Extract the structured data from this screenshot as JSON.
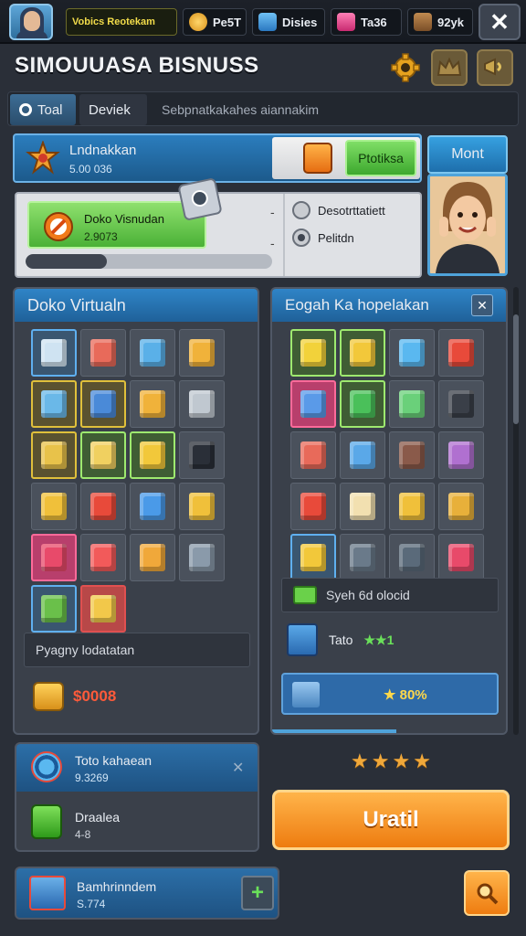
{
  "topbar": {
    "resources": [
      {
        "label": "Vobics Reotekam",
        "icon": "ribbon-icon",
        "color": "#d8c238"
      },
      {
        "label": "Pe5T",
        "icon": "gear-coin-icon",
        "color": "#e9a62a"
      },
      {
        "label": "Disies",
        "icon": "blue-crate-icon",
        "color": "#3b8fd8"
      },
      {
        "label": "Ta36",
        "icon": "pink-box-icon",
        "color": "#e2438a"
      },
      {
        "label": "92yk",
        "icon": "barrel-icon",
        "color": "#9a6a3a"
      }
    ],
    "close_label": "✕"
  },
  "header": {
    "title": "SIMOUUASA BISNUSS",
    "icons": [
      "settings-icon",
      "crown-icon",
      "megaphone-icon"
    ]
  },
  "tabs": [
    {
      "label": "Toal",
      "icon": "search-icon"
    },
    {
      "label": "Deviek"
    },
    {
      "label": "Sebpnatkakahes aiannakim"
    }
  ],
  "summary": {
    "label": "Lndnakkan",
    "value": "5.00 036",
    "button_label": "Ptotiksa",
    "menu_label": "Mont"
  },
  "progress": {
    "title": "Doko Visnudan",
    "value": "2.9073",
    "fraction": 0.33,
    "options": [
      "Desotrttatiett",
      "Pelitdn"
    ],
    "selected_option": "Pelitdn"
  },
  "left_panel": {
    "title": "Doko Virtualn",
    "footer_label": "Pyagny lodatatan",
    "coin_value": "$0008"
  },
  "right_panel": {
    "title": "Eogah Ka hopelakan",
    "close_label": "✕",
    "row1_label": "Syeh 6d olocid",
    "row2_label": "Tato",
    "row2_stars": "★★1",
    "row3_label": "★ 80%"
  },
  "rating": {
    "stars_filled": 3,
    "stars_total": 4
  },
  "cards": [
    {
      "title": "Toto kahaean",
      "value": "9.3269",
      "close_label": "✕"
    },
    {
      "title": "Draalea",
      "value": "4-8"
    },
    {
      "title": "Bamhrinndem",
      "value": "S.774",
      "add_label": "+"
    }
  ],
  "primary_button": {
    "label": "Uratil"
  },
  "colors": {
    "accent_blue": "#2f84c7",
    "accent_orange": "#ee7c10",
    "accent_green": "#4ab136"
  }
}
